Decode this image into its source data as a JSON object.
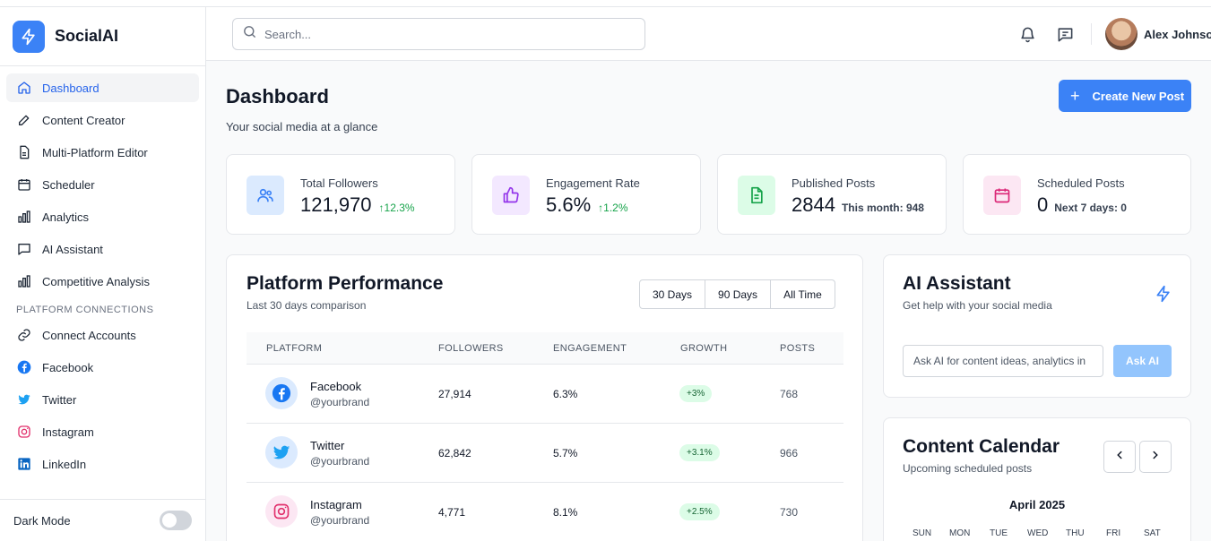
{
  "brand": {
    "name": "SocialAI"
  },
  "sidebar": {
    "items": [
      {
        "label": "Dashboard",
        "icon": "home-icon",
        "active": true
      },
      {
        "label": "Content Creator",
        "icon": "edit-icon"
      },
      {
        "label": "Multi-Platform Editor",
        "icon": "document-icon"
      },
      {
        "label": "Scheduler",
        "icon": "calendar-icon"
      },
      {
        "label": "Analytics",
        "icon": "bar-chart-icon"
      },
      {
        "label": "AI Assistant",
        "icon": "chat-icon"
      },
      {
        "label": "Competitive Analysis",
        "icon": "bar-chart-icon"
      }
    ],
    "section_label": "PLATFORM CONNECTIONS",
    "connections": [
      {
        "label": "Connect Accounts",
        "icon": "link-icon"
      },
      {
        "label": "Facebook",
        "icon": "facebook-icon",
        "color": "#1877f2"
      },
      {
        "label": "Twitter",
        "icon": "twitter-icon",
        "color": "#1da1f2"
      },
      {
        "label": "Instagram",
        "icon": "instagram-icon",
        "color": "#e1306c"
      },
      {
        "label": "LinkedIn",
        "icon": "linkedin-icon",
        "color": "#0a66c2"
      }
    ],
    "dark_mode_label": "Dark Mode"
  },
  "header": {
    "search_placeholder": "Search...",
    "user_name": "Alex Johnson"
  },
  "page": {
    "title": "Dashboard",
    "subtitle": "Your social media at a glance",
    "create_button": "Create New Post"
  },
  "stats": [
    {
      "label": "Total Followers",
      "value": "121,970",
      "delta": "12.3%",
      "icon": "users-icon"
    },
    {
      "label": "Engagement Rate",
      "value": "5.6%",
      "delta": "1.2%",
      "icon": "thumbs-up-icon"
    },
    {
      "label": "Published Posts",
      "value": "2844",
      "extra": "This month: 948",
      "icon": "document-icon"
    },
    {
      "label": "Scheduled Posts",
      "value": "0",
      "extra": "Next 7 days: 0",
      "icon": "calendar-icon"
    }
  ],
  "performance": {
    "title": "Platform Performance",
    "subtitle": "Last 30 days comparison",
    "ranges": [
      "30 Days",
      "90 Days",
      "All Time"
    ],
    "columns": [
      "PLATFORM",
      "FOLLOWERS",
      "ENGAGEMENT",
      "GROWTH",
      "POSTS"
    ],
    "rows": [
      {
        "name": "Facebook",
        "handle": "@yourbrand",
        "followers": "27,914",
        "engagement": "6.3%",
        "growth": "+3%",
        "posts": "768",
        "icon": "facebook-icon"
      },
      {
        "name": "Twitter",
        "handle": "@yourbrand",
        "followers": "62,842",
        "engagement": "5.7%",
        "growth": "+3.1%",
        "posts": "966",
        "icon": "twitter-icon"
      },
      {
        "name": "Instagram",
        "handle": "@yourbrand",
        "followers": "4,771",
        "engagement": "8.1%",
        "growth": "+2.5%",
        "posts": "730",
        "icon": "instagram-icon"
      }
    ]
  },
  "assistant": {
    "title": "AI Assistant",
    "subtitle": "Get help with your social media",
    "input_placeholder": "Ask AI for content ideas, analytics in",
    "button": "Ask AI"
  },
  "calendar": {
    "title": "Content Calendar",
    "subtitle": "Upcoming scheduled posts",
    "month": "April 2025",
    "days": [
      "SUN",
      "MON",
      "TUE",
      "WED",
      "THU",
      "FRI",
      "SAT"
    ]
  },
  "colors": {
    "accent": "#3b82f6",
    "growth_bg": "#dcfce7",
    "growth_text": "#166534"
  }
}
